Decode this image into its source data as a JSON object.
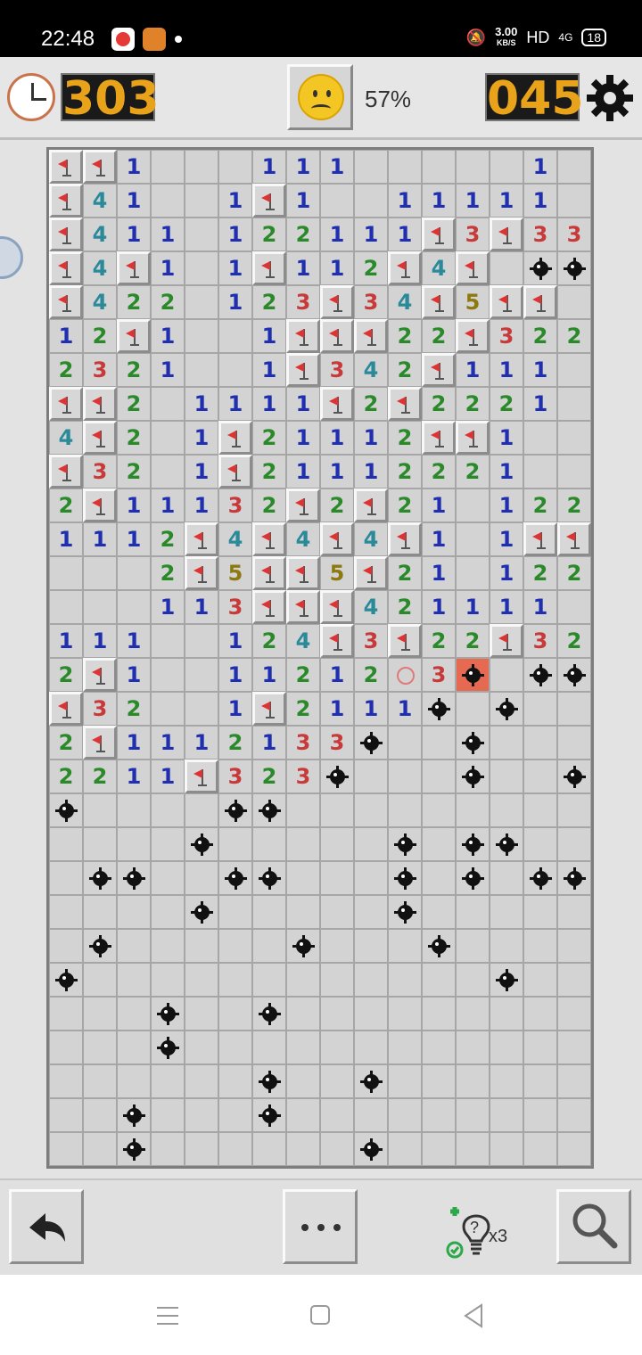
{
  "status_bar": {
    "time": "22:48",
    "speed_value": "3.00",
    "speed_unit": "KB/S",
    "hd": "HD",
    "network": "4G",
    "battery": "18",
    "icons": [
      "youtube-icon",
      "game-app-icon",
      "mute-bell-icon",
      "signal-icon",
      "battery-icon"
    ]
  },
  "game": {
    "timer": "303",
    "mines_left": "045",
    "progress": "57%",
    "face_state": "sad",
    "hint_count": "x3"
  },
  "board": {
    "columns": 16,
    "rows": 30,
    "legend": {
      "#": "closed",
      "F": "flag",
      "M": "mine",
      "X": "exploded mine",
      "W": "wrong flag",
      "0": "empty open",
      "1": "1",
      "2": "2",
      "3": "3",
      "4": "4",
      "5": "5"
    },
    "grid": [
      "FF10001110000010",
      "F41001F100111110",
      "F4110122111F3F33",
      "F4F101F112F4F0MM",
      "F4220123F34F5FF",
      "12F1001FFF22F322",
      "2321001F342F1110",
      "FF201111F2F22210",
      "4F201F21112FF100",
      "F3201F2111222100",
      "2F11132F2F210122",
      "1112F4F4F4F101FF",
      "0002F5FF5F210122",
      "000113FFF4211110",
      "11100124F3F22F32",
      "2F1001121 2W3X0MM",
      "F32001F2111M0M00",
      "2F1112133M00M000",
      "2211F323M000M00M",
      "M0000MM000000000M",
      "0000M00000M0MM0",
      "0MM00MM000M0M0MM",
      "0000M00000M00000",
      "0M00000M000M0000",
      "M000000000000M00",
      "000M00M000000000",
      "000M000000000000",
      "000000M00M000000",
      "00M000M000000000",
      "00M000000M000000"
    ]
  }
}
